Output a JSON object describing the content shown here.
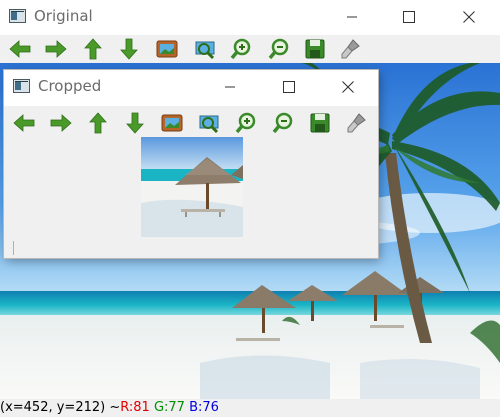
{
  "original_window": {
    "title": "Original",
    "controls": {
      "minimize": "minimize",
      "maximize": "maximize",
      "close": "close"
    }
  },
  "cropped_window": {
    "title": "Cropped"
  },
  "toolbar": {
    "buttons": [
      {
        "name": "pan-left",
        "icon": "arrow-left-icon",
        "color": "#4a9a2a"
      },
      {
        "name": "pan-right",
        "icon": "arrow-right-icon",
        "color": "#4a9a2a"
      },
      {
        "name": "pan-up",
        "icon": "arrow-up-icon",
        "color": "#4a9a2a"
      },
      {
        "name": "pan-down",
        "icon": "arrow-down-icon",
        "color": "#4a9a2a"
      },
      {
        "name": "zoom-to-image",
        "icon": "image-icon",
        "color": "#a0521d"
      },
      {
        "name": "zoom-to-region",
        "icon": "zoom-region-icon",
        "color": "#3a8a3a"
      },
      {
        "name": "zoom-in",
        "icon": "zoom-in-icon",
        "color": "#3a8a3a"
      },
      {
        "name": "zoom-out",
        "icon": "zoom-out-icon",
        "color": "#3a8a3a"
      },
      {
        "name": "save",
        "icon": "save-icon",
        "color": "#3a8a3a"
      },
      {
        "name": "properties",
        "icon": "brush-icon",
        "color": "#8a8a8a"
      }
    ]
  },
  "status": {
    "coords": "(x=452, y=212) ~ ",
    "r": "R:81",
    "g": "G:77",
    "b": "B:76"
  },
  "colors": {
    "sky_top": "#2f7ad8",
    "sea": "#19a9c0",
    "sand": "#f4f4f2"
  }
}
